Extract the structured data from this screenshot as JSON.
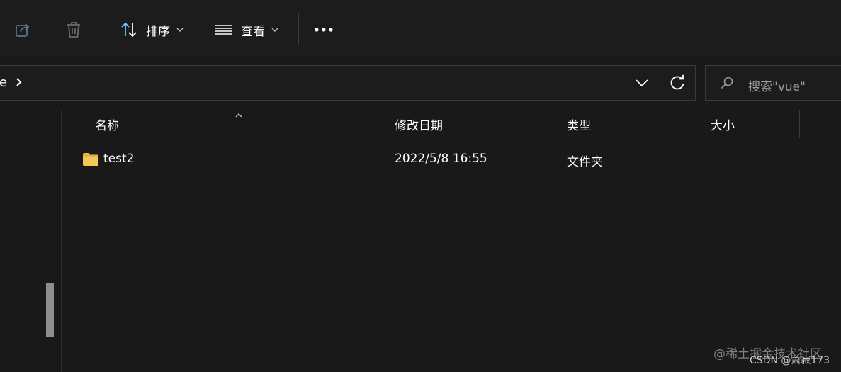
{
  "toolbar": {
    "share_icon": "share-icon",
    "delete_icon": "trash-icon",
    "sort_label": "排序",
    "view_label": "查看",
    "more_icon": "more-icon"
  },
  "address": {
    "path_tail": "e",
    "separator": "›"
  },
  "search": {
    "placeholder": "搜索\"vue\""
  },
  "columns": {
    "name": "名称",
    "date": "修改日期",
    "type": "类型",
    "size": "大小"
  },
  "rows": [
    {
      "name": "test2",
      "date": "2022/5/8 16:55",
      "type": "文件夹",
      "size": ""
    }
  ],
  "watermark": {
    "line1": "@稀土掘金技术社区",
    "line2": "CSDN @萧寂173"
  },
  "colors": {
    "background": "#191919",
    "toolbar": "#1c1c1c",
    "sort_accent": "#60cdff",
    "folder": "#f3c855"
  }
}
